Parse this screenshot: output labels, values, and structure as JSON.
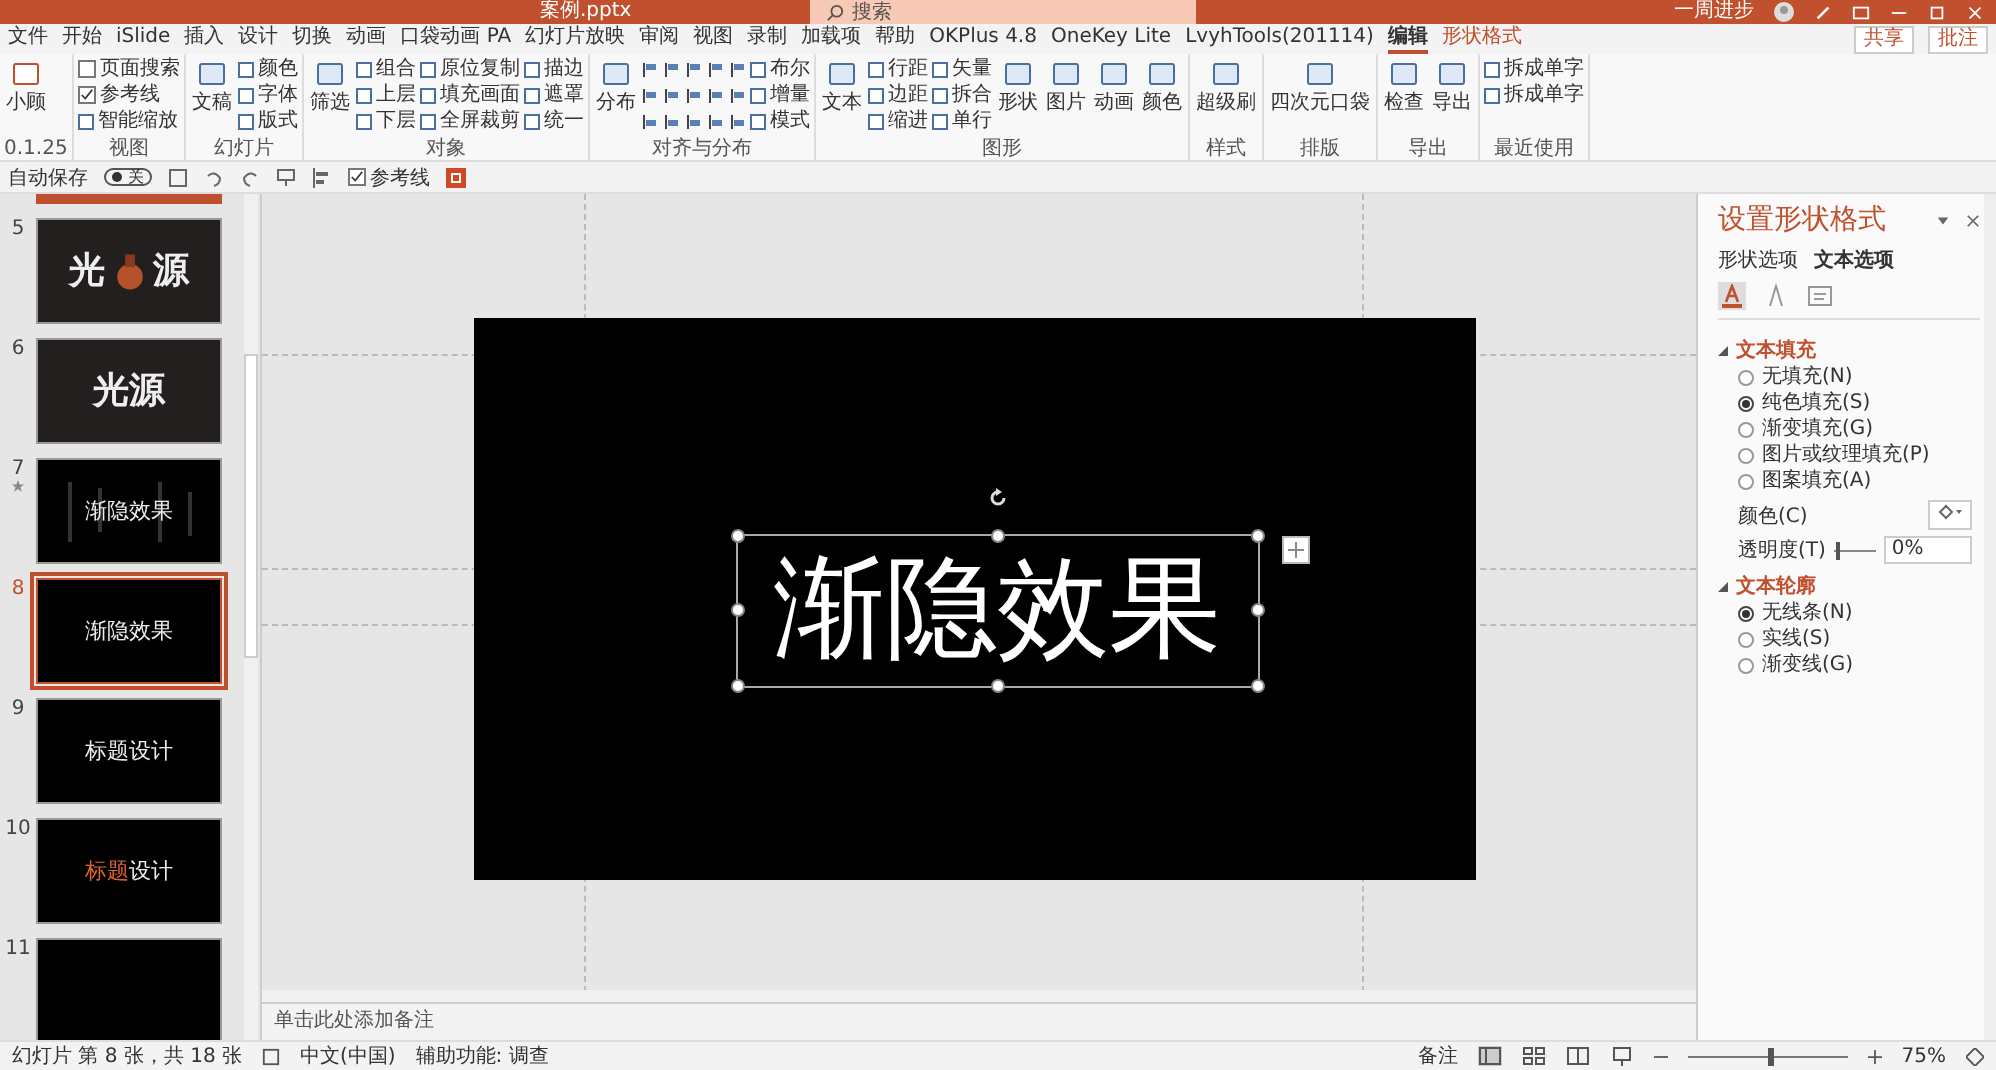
{
  "window": {
    "title": "案例.pptx",
    "search_placeholder": "搜索",
    "user": "一周进步"
  },
  "tabs": [
    {
      "label": "文件",
      "selected": false,
      "contextual": false
    },
    {
      "label": "开始",
      "selected": false,
      "contextual": false
    },
    {
      "label": "iSlide",
      "selected": false,
      "contextual": false
    },
    {
      "label": "插入",
      "selected": false,
      "contextual": false
    },
    {
      "label": "设计",
      "selected": false,
      "contextual": false
    },
    {
      "label": "切换",
      "selected": false,
      "contextual": false
    },
    {
      "label": "动画",
      "selected": false,
      "contextual": false
    },
    {
      "label": "口袋动画 PA",
      "selected": false,
      "contextual": false
    },
    {
      "label": "幻灯片放映",
      "selected": false,
      "contextual": false
    },
    {
      "label": "审阅",
      "selected": false,
      "contextual": false
    },
    {
      "label": "视图",
      "selected": false,
      "contextual": false
    },
    {
      "label": "录制",
      "selected": false,
      "contextual": false
    },
    {
      "label": "加载项",
      "selected": false,
      "contextual": false
    },
    {
      "label": "帮助",
      "selected": false,
      "contextual": false
    },
    {
      "label": "OKPlus 4.8",
      "selected": false,
      "contextual": false
    },
    {
      "label": "OneKey Lite",
      "selected": false,
      "contextual": false
    },
    {
      "label": "LvyhTools(201114)",
      "selected": false,
      "contextual": false
    },
    {
      "label": "编辑",
      "selected": true,
      "contextual": false
    },
    {
      "label": "形状格式",
      "selected": false,
      "contextual": true
    }
  ],
  "share": "共享",
  "comments": "批注",
  "ribbon": [
    {
      "label": "0.1.25",
      "items": [
        {
          "kind": "big",
          "label": "小顾"
        }
      ]
    },
    {
      "label": "视图",
      "items": [
        {
          "kind": "check",
          "label": "页面搜索",
          "checked": false
        },
        {
          "kind": "check",
          "label": "参考线",
          "checked": true
        },
        {
          "kind": "small",
          "label": "智能缩放"
        }
      ]
    },
    {
      "label": "幻灯片",
      "items": [
        {
          "kind": "big",
          "label": "文稿"
        },
        {
          "kind": "small",
          "label": "颜色"
        },
        {
          "kind": "small",
          "label": "字体"
        },
        {
          "kind": "small",
          "label": "版式"
        }
      ]
    },
    {
      "label": "对象",
      "items": [
        {
          "kind": "big",
          "label": "筛选"
        },
        {
          "kind": "small",
          "label": "组合"
        },
        {
          "kind": "small",
          "label": "上层"
        },
        {
          "kind": "small",
          "label": "下层"
        },
        {
          "kind": "small",
          "label": "原位复制"
        },
        {
          "kind": "small",
          "label": "填充画面"
        },
        {
          "kind": "small",
          "label": "全屏裁剪"
        },
        {
          "kind": "small",
          "label": "描边"
        },
        {
          "kind": "small",
          "label": "遮罩"
        },
        {
          "kind": "small",
          "label": "统一"
        }
      ]
    },
    {
      "label": "对齐与分布",
      "items": [
        {
          "kind": "big",
          "label": "分布"
        },
        {
          "kind": "align"
        },
        {
          "kind": "small",
          "label": "布尔"
        },
        {
          "kind": "small",
          "label": "增量"
        },
        {
          "kind": "small",
          "label": "模式"
        }
      ]
    },
    {
      "label": "图形",
      "items": [
        {
          "kind": "big",
          "label": "文本"
        },
        {
          "kind": "small",
          "label": "行距"
        },
        {
          "kind": "small",
          "label": "边距"
        },
        {
          "kind": "small",
          "label": "缩进"
        },
        {
          "kind": "small",
          "label": "矢量"
        },
        {
          "kind": "small",
          "label": "拆合"
        },
        {
          "kind": "small",
          "label": "单行"
        },
        {
          "kind": "big",
          "label": "形状"
        },
        {
          "kind": "big",
          "label": "图片"
        },
        {
          "kind": "big",
          "label": "动画"
        },
        {
          "kind": "big",
          "label": "颜色"
        }
      ]
    },
    {
      "label": "样式",
      "items": [
        {
          "kind": "big",
          "label": "超级刷"
        }
      ]
    },
    {
      "label": "排版",
      "items": [
        {
          "kind": "big",
          "label": "四次元口袋"
        }
      ]
    },
    {
      "label": "导出",
      "items": [
        {
          "kind": "big",
          "label": "检查"
        },
        {
          "kind": "big",
          "label": "导出"
        }
      ]
    },
    {
      "label": "最近使用",
      "items": [
        {
          "kind": "small",
          "label": "拆成单字"
        },
        {
          "kind": "small",
          "label": "拆成单字"
        }
      ]
    }
  ],
  "quick_access": {
    "autosave_label": "自动保存",
    "autosave_on": false,
    "autosave_state": "关",
    "guides_label": "参考线",
    "guides_checked": true
  },
  "slides": [
    {
      "number": "5",
      "selected": false,
      "animated": false,
      "kind": "vase",
      "parts": [
        {
          "text": "光",
          "highlight": false
        },
        {
          "text": "源",
          "highlight": false
        }
      ]
    },
    {
      "number": "6",
      "selected": false,
      "animated": false,
      "kind": "plain",
      "parts": [
        {
          "text": "光源",
          "highlight": false
        }
      ]
    },
    {
      "number": "7",
      "selected": false,
      "animated": true,
      "kind": "lines",
      "parts": [
        {
          "text": "渐隐效果",
          "highlight": false
        }
      ]
    },
    {
      "number": "8",
      "selected": true,
      "animated": false,
      "kind": "black",
      "parts": [
        {
          "text": "渐隐效果",
          "highlight": false
        }
      ]
    },
    {
      "number": "9",
      "selected": false,
      "animated": false,
      "kind": "black",
      "parts": [
        {
          "text": "标题设计",
          "highlight": false
        }
      ]
    },
    {
      "number": "10",
      "selected": false,
      "animated": false,
      "kind": "black",
      "parts": [
        {
          "text": "标题",
          "highlight": true
        },
        {
          "text": "设计",
          "highlight": false
        }
      ]
    },
    {
      "number": "11",
      "selected": false,
      "animated": false,
      "kind": "black"
    }
  ],
  "slide": {
    "text": "渐隐效果",
    "notes_placeholder": "单击此处添加备注"
  },
  "format_pane": {
    "title": "设置形状格式",
    "tabs": [
      {
        "label": "形状选项",
        "selected": false
      },
      {
        "label": "文本选项",
        "selected": true
      }
    ],
    "icon_tabs": [
      {
        "kind": "fill",
        "selected": true
      },
      {
        "kind": "outline",
        "selected": false
      },
      {
        "kind": "textbox",
        "selected": false
      }
    ],
    "sections": [
      {
        "title": "文本填充",
        "expanded": true,
        "options": [
          {
            "label": "无填充(N)",
            "selected": false
          },
          {
            "label": "纯色填充(S)",
            "selected": true
          },
          {
            "label": "渐变填充(G)",
            "selected": false
          },
          {
            "label": "图片或纹理填充(P)",
            "selected": false
          },
          {
            "label": "图案填充(A)",
            "selected": false
          }
        ],
        "color_label": "颜色(C)",
        "transparency_label": "透明度(T)",
        "transparency": {
          "level": 0,
          "value": "0%"
        }
      },
      {
        "title": "文本轮廓",
        "expanded": true,
        "options": [
          {
            "label": "无线条(N)",
            "selected": true
          },
          {
            "label": "实线(S)",
            "selected": false
          },
          {
            "label": "渐变线(G)",
            "selected": false
          }
        ]
      }
    ]
  },
  "status_bar": {
    "slide_info": "幻灯片 第 8 张，共 18 张",
    "language": "中文(中国)",
    "accessibility": "辅助功能: 调查",
    "notes": "备注",
    "zoom": {
      "level": 0.5,
      "value": "75%"
    }
  }
}
